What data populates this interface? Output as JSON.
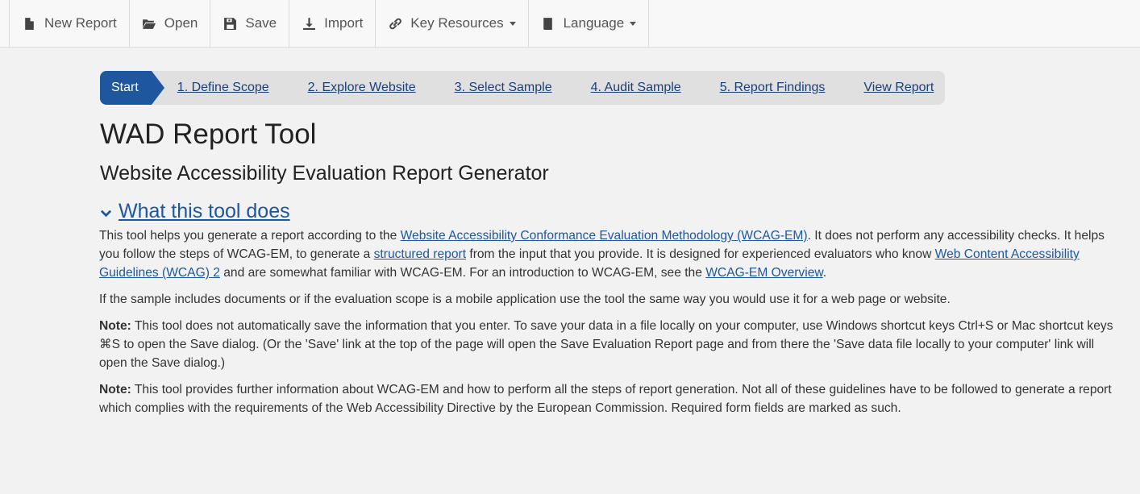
{
  "toolbar": {
    "items": [
      {
        "label": "New Report",
        "icon": "file-icon"
      },
      {
        "label": "Open",
        "icon": "folder-open-icon"
      },
      {
        "label": "Save",
        "icon": "save-icon"
      },
      {
        "label": "Import",
        "icon": "import-icon"
      },
      {
        "label": "Key Resources",
        "icon": "link-icon",
        "dropdown": true
      },
      {
        "label": "Language",
        "icon": "book-icon",
        "dropdown": true
      }
    ]
  },
  "steps": [
    "Start",
    "1. Define Scope",
    "2. Explore Website",
    "3. Select Sample",
    "4. Audit Sample",
    "5. Report Findings",
    "View Report"
  ],
  "page": {
    "title": "WAD Report Tool",
    "subtitle": "Website Accessibility Evaluation Report Generator",
    "section_toggle": "What this tool does"
  },
  "para1": {
    "t1": "This tool helps you generate a report according to the ",
    "l1": "Website Accessibility Conformance Evaluation Methodology (WCAG-EM)",
    "t2": ". It does not perform any accessibility checks. It helps you follow the steps of WCAG-EM, to generate a ",
    "l2": "structured report",
    "t3": " from the input that you provide. It is designed for experienced evaluators who know ",
    "l3": "Web Content Accessibility Guidelines (WCAG) 2",
    "t4": " and are somewhat familiar with WCAG-EM. For an introduction to WCAG-EM, see the ",
    "l4": "WCAG-EM Overview",
    "t5": "."
  },
  "para2": "If the sample includes documents or if the evaluation scope is a mobile application use the tool the same way you would use it for a web page or website.",
  "para3": {
    "label": "Note:",
    "text": " This tool does not automatically save the information that you enter. To save your data in a file locally on your computer, use Windows shortcut keys Ctrl+S or Mac shortcut keys ⌘S to open the Save dialog. (Or the 'Save' link at the top of the page will open the Save Evaluation Report page and from there the 'Save data file locally to your computer' link will open the Save dialog.)"
  },
  "para4": {
    "label": "Note:",
    "text": " This tool provides further information about WCAG-EM and how to perform all the steps of report generation. Not all of these guidelines have to be followed to generate a report which complies with the requirements of the Web Accessibility Directive by the European Commission. Required form fields are marked as such."
  }
}
